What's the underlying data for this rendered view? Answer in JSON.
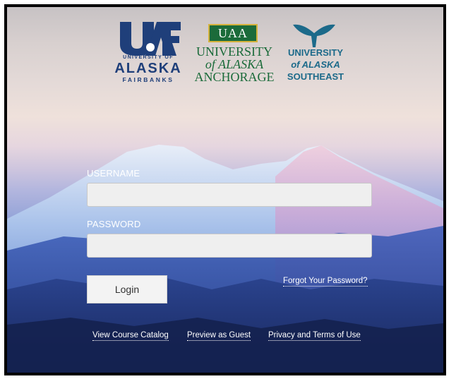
{
  "logos": {
    "uaf": {
      "line1": "UNIVERSITY OF",
      "line2": "ALASKA",
      "line3": "FAIRBANKS",
      "mark": "UAF"
    },
    "uaa": {
      "badge": "UAA",
      "line1": "UNIVERSITY",
      "line2": "of ALASKA",
      "line3": "ANCHORAGE"
    },
    "uas": {
      "line1": "UNIVERSITY",
      "line2": "of ALASKA",
      "line3": "SOUTHEAST"
    }
  },
  "form": {
    "username_label": "USERNAME",
    "username_value": "",
    "password_label": "PASSWORD",
    "password_value": "",
    "login_button": "Login",
    "forgot_link": "Forgot Your Password?"
  },
  "footer_links": [
    "View Course Catalog",
    "Preview as Guest",
    "Privacy and Terms of Use"
  ],
  "colors": {
    "uaf_blue": "#1f3f7a",
    "uaa_green": "#1b6b3a",
    "uaa_gold": "#d4b23b",
    "uas_teal": "#1c6a8a",
    "frame": "#000000"
  }
}
